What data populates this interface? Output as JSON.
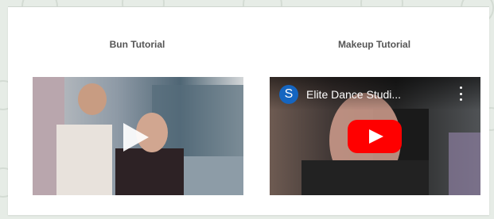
{
  "videos": [
    {
      "heading": "Bun Tutorial"
    },
    {
      "heading": "Makeup Tutorial",
      "channel_initial": "S",
      "title": "Elite Dance Studi..."
    }
  ],
  "icons": [
    "play-icon",
    "youtube-play-icon",
    "more-vert-icon"
  ],
  "colors": {
    "page_bg": "#e6ece6",
    "card_bg": "#ffffff",
    "youtube_red": "#ff0000",
    "avatar_blue": "#1565c0"
  }
}
